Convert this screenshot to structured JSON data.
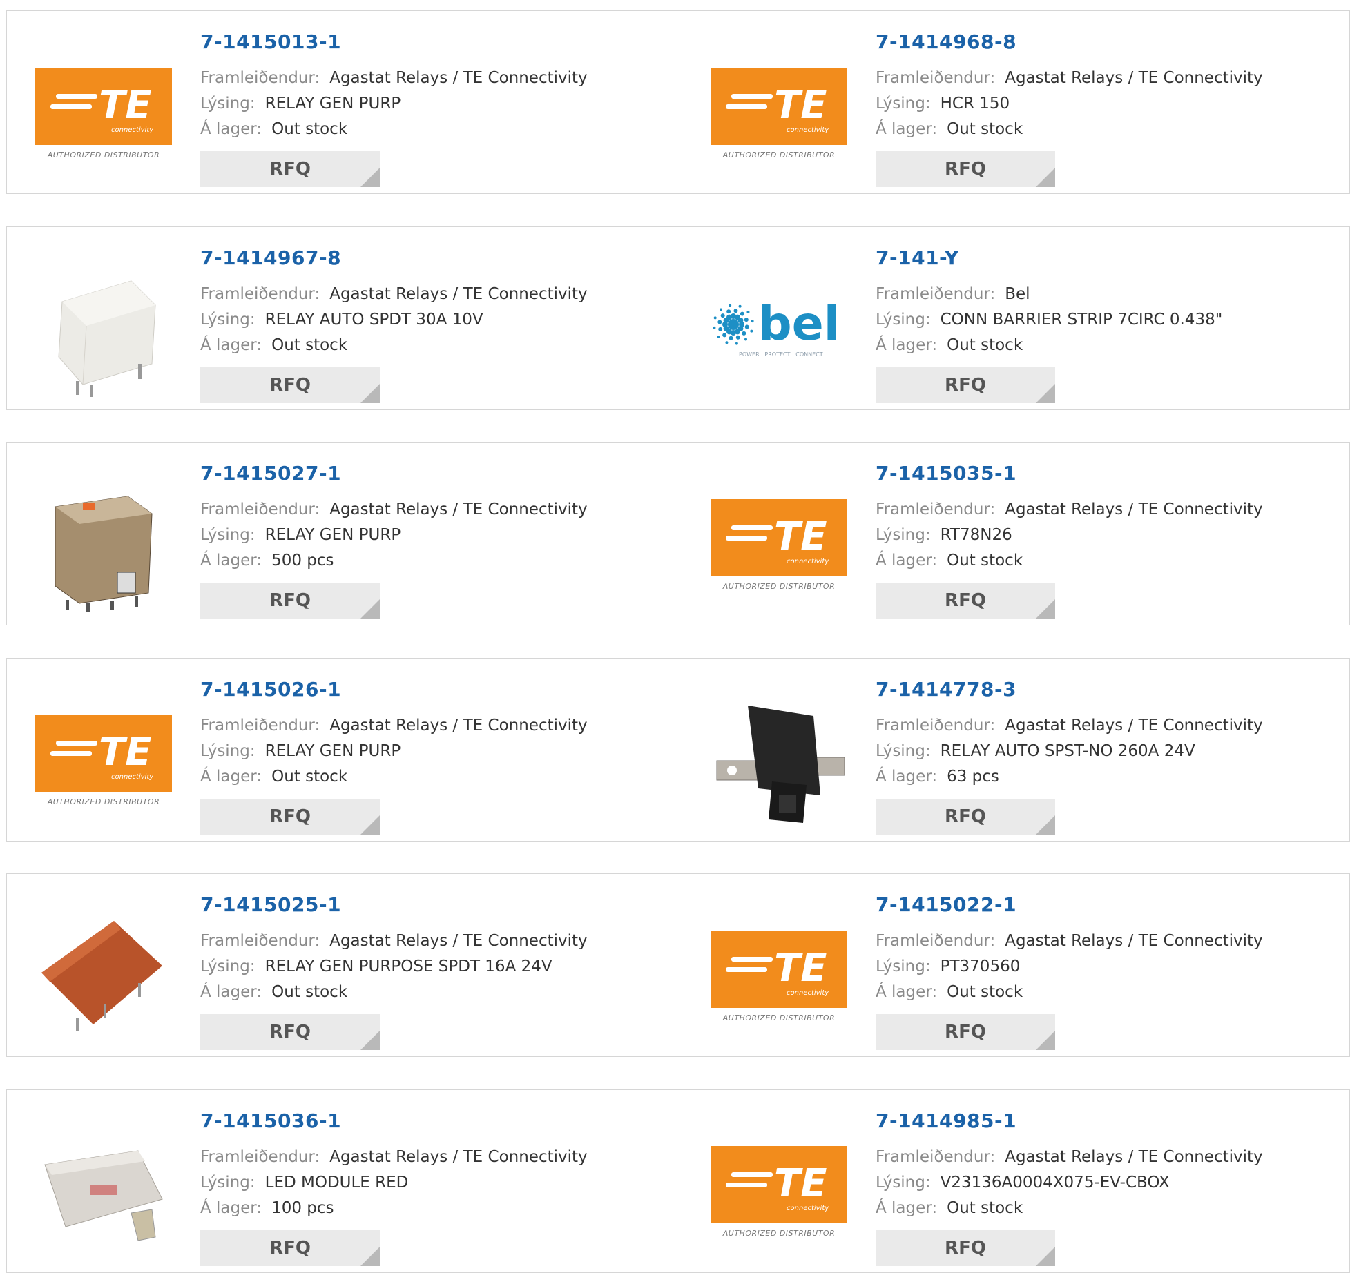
{
  "labels": {
    "manufacturer": "Framleiðendur:",
    "description": "Lýsing:",
    "stock": "Á lager:",
    "rfq": "RFQ"
  },
  "logo_text": {
    "te_word": "TE",
    "te_sub": "connectivity",
    "te_caption": "AUTHORIZED DISTRIBUTOR",
    "bel_word": "bel",
    "bel_sub": "POWER | PROTECT | CONNECT"
  },
  "colors": {
    "link": "#1b62a8",
    "te_orange": "#f28c1c",
    "bel_blue": "#1d8fc5"
  },
  "products": [
    {
      "pn": "7-1415013-1",
      "manufacturer": "Agastat Relays / TE Connectivity",
      "description": "RELAY GEN PURP",
      "stock": "Out stock",
      "image": "te-logo"
    },
    {
      "pn": "7-1414968-8",
      "manufacturer": "Agastat Relays / TE Connectivity",
      "description": "HCR 150",
      "stock": "Out stock",
      "image": "te-logo"
    },
    {
      "pn": "7-1414967-8",
      "manufacturer": "Agastat Relays / TE Connectivity",
      "description": "RELAY AUTO SPDT 30A 10V",
      "stock": "Out stock",
      "image": "white-relay"
    },
    {
      "pn": "7-141-Y",
      "manufacturer": "Bel",
      "description": "CONN BARRIER STRIP 7CIRC 0.438\"",
      "stock": "Out stock",
      "image": "bel-logo"
    },
    {
      "pn": "7-1415027-1",
      "manufacturer": "Agastat Relays / TE Connectivity",
      "description": "RELAY GEN PURP",
      "stock": "500 pcs",
      "image": "clear-relay"
    },
    {
      "pn": "7-1415035-1",
      "manufacturer": "Agastat Relays / TE Connectivity",
      "description": "RT78N26",
      "stock": "Out stock",
      "image": "te-logo"
    },
    {
      "pn": "7-1415026-1",
      "manufacturer": "Agastat Relays / TE Connectivity",
      "description": "RELAY GEN PURP",
      "stock": "Out stock",
      "image": "te-logo"
    },
    {
      "pn": "7-1414778-3",
      "manufacturer": "Agastat Relays / TE Connectivity",
      "description": "RELAY AUTO SPST-NO 260A 24V",
      "stock": "63 pcs",
      "image": "black-relay"
    },
    {
      "pn": "7-1415025-1",
      "manufacturer": "Agastat Relays / TE Connectivity",
      "description": "RELAY GEN PURPOSE SPDT 16A 24V",
      "stock": "Out stock",
      "image": "orange-relay"
    },
    {
      "pn": "7-1415022-1",
      "manufacturer": "Agastat Relays / TE Connectivity",
      "description": "PT370560",
      "stock": "Out stock",
      "image": "te-logo"
    },
    {
      "pn": "7-1415036-1",
      "manufacturer": "Agastat Relays / TE Connectivity",
      "description": "LED MODULE RED",
      "stock": "100 pcs",
      "image": "led-module"
    },
    {
      "pn": "7-1414985-1",
      "manufacturer": "Agastat Relays / TE Connectivity",
      "description": "V23136A0004X075-EV-CBOX",
      "stock": "Out stock",
      "image": "te-logo"
    }
  ]
}
